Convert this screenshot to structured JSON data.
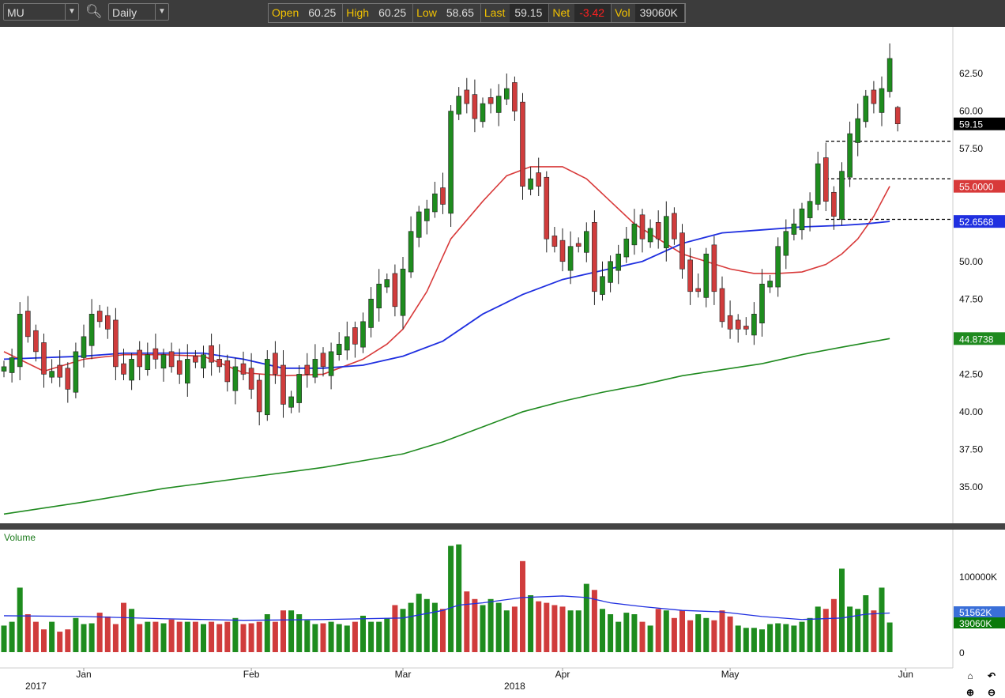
{
  "toolbar": {
    "symbol": "MU",
    "interval": "Daily",
    "search_icon": "magnifier-icon",
    "quote": [
      {
        "label": "Open",
        "value": "60.25"
      },
      {
        "label": "High",
        "value": "60.25"
      },
      {
        "label": "Low",
        "value": "58.65"
      },
      {
        "label": "Last",
        "value": "59.15"
      },
      {
        "label": "Net",
        "value": "-3.42"
      },
      {
        "label": "Vol",
        "value": "39060K"
      }
    ]
  },
  "colors": {
    "up": "#1e8c1e",
    "down": "#d03c3c",
    "ma20": "#d83a3a",
    "ma50": "#1f2fe0",
    "ma200": "#1f8a1f",
    "net": "#ff2020"
  },
  "chart_data": {
    "type": "candlestick",
    "symbol": "MU",
    "price_axis": {
      "ylim": [
        32.5,
        65
      ],
      "ticks": [
        "35.00",
        "37.50",
        "40.00",
        "42.50",
        "45.00",
        "47.50",
        "50.00",
        "52.50",
        "55.00",
        "57.50",
        "60.00",
        "62.50"
      ]
    },
    "x_labels": [
      {
        "label": "Jan",
        "index": 10
      },
      {
        "label": "Feb",
        "index": 31
      },
      {
        "label": "Mar",
        "index": 50
      },
      {
        "label": "Apr",
        "index": 70
      },
      {
        "label": "May",
        "index": 91
      },
      {
        "label": "Jun",
        "index": 113
      }
    ],
    "year_labels": [
      {
        "label": "2017",
        "index": 4
      },
      {
        "label": "2018",
        "index": 64
      }
    ],
    "closes": [
      43.0,
      43.6,
      46.5,
      45,
      44,
      42.5,
      42.7,
      42.3,
      41.5,
      44,
      45,
      46.5,
      46,
      45.5,
      43,
      42.5,
      43.5,
      43,
      43.8,
      43.5,
      43.8,
      43,
      42.5,
      43.5,
      43.3,
      43.8,
      43.3,
      43,
      42,
      43,
      42.5,
      41.5,
      40,
      43.5,
      42.5,
      40.5,
      41,
      42.5,
      42.5,
      43.5,
      43,
      44,
      44.5,
      45,
      44.5,
      46,
      47.5,
      48.5,
      48.8,
      47,
      49.5,
      52,
      53.3,
      53.5,
      54.5,
      53.8,
      60,
      61,
      60.5,
      59.5,
      60.5,
      60.5,
      61,
      61.5,
      60,
      55,
      55.5,
      55,
      51.5,
      51,
      50,
      51,
      51,
      52,
      48,
      49,
      50,
      50.5,
      51.5,
      52.5,
      51.5,
      52.2,
      51.5,
      53,
      51.5,
      49.5,
      48,
      48,
      50.5,
      48,
      46,
      45.5,
      45.5,
      45.5,
      46.5,
      48.5,
      48.7,
      51,
      52,
      52.5,
      53.5,
      54,
      56.5,
      54,
      53,
      56,
      58.5,
      59.5,
      61,
      60.5,
      61.5,
      63.5
    ],
    "last_candle": {
      "open": 60.25,
      "high": 60.25,
      "low": 58.65,
      "close": 59.15
    },
    "moving_averages": [
      {
        "name": "MA20",
        "badge": "55.0000",
        "points": [
          [
            0,
            44
          ],
          [
            5,
            42.7
          ],
          [
            10,
            43.5
          ],
          [
            15,
            43.8
          ],
          [
            20,
            43.8
          ],
          [
            25,
            43.7
          ],
          [
            30,
            42.6
          ],
          [
            35,
            42.4
          ],
          [
            40,
            42.5
          ],
          [
            45,
            43.5
          ],
          [
            48,
            44.5
          ],
          [
            50,
            45.5
          ],
          [
            53,
            48
          ],
          [
            56,
            51.5
          ],
          [
            60,
            54
          ],
          [
            63,
            55.7
          ],
          [
            66,
            56.3
          ],
          [
            70,
            56.3
          ],
          [
            73,
            55.5
          ],
          [
            76,
            54
          ],
          [
            79,
            52.5
          ],
          [
            82,
            51.5
          ],
          [
            85,
            50.5
          ],
          [
            88,
            50
          ],
          [
            91,
            49.5
          ],
          [
            94,
            49.2
          ],
          [
            97,
            49.2
          ],
          [
            100,
            49.3
          ],
          [
            103,
            49.8
          ],
          [
            105,
            50.5
          ],
          [
            107,
            51.5
          ],
          [
            109,
            53
          ],
          [
            111,
            55
          ]
        ]
      },
      {
        "name": "MA50",
        "badge": "52.6568",
        "points": [
          [
            0,
            43.5
          ],
          [
            10,
            43.7
          ],
          [
            15,
            43.9
          ],
          [
            25,
            43.9
          ],
          [
            30,
            43.5
          ],
          [
            35,
            42.9
          ],
          [
            40,
            42.9
          ],
          [
            45,
            43.1
          ],
          [
            50,
            43.7
          ],
          [
            55,
            44.7
          ],
          [
            60,
            46.5
          ],
          [
            65,
            47.8
          ],
          [
            70,
            48.8
          ],
          [
            75,
            49.4
          ],
          [
            80,
            50
          ],
          [
            85,
            51.2
          ],
          [
            90,
            51.9
          ],
          [
            95,
            52.1
          ],
          [
            100,
            52.3
          ],
          [
            105,
            52.4
          ],
          [
            108,
            52.5
          ],
          [
            111,
            52.66
          ]
        ]
      },
      {
        "name": "MA200",
        "badge": "44.8738",
        "points": [
          [
            0,
            33.2
          ],
          [
            10,
            34
          ],
          [
            20,
            34.9
          ],
          [
            30,
            35.6
          ],
          [
            40,
            36.3
          ],
          [
            50,
            37.2
          ],
          [
            55,
            38
          ],
          [
            60,
            39
          ],
          [
            65,
            40
          ],
          [
            70,
            40.7
          ],
          [
            75,
            41.3
          ],
          [
            80,
            41.8
          ],
          [
            85,
            42.4
          ],
          [
            90,
            42.8
          ],
          [
            95,
            43.2
          ],
          [
            100,
            43.8
          ],
          [
            105,
            44.3
          ],
          [
            111,
            44.87
          ]
        ]
      }
    ],
    "last_badge": "59.15",
    "support_lines": [
      58.0,
      55.5,
      52.8
    ],
    "volume": {
      "label": "Volume",
      "ticks": [
        "100000K",
        "0"
      ],
      "ma_badge": "51562K",
      "last_badge": "39060K",
      "values": [
        35000,
        40000,
        85000,
        50000,
        40000,
        30000,
        40000,
        27000,
        30000,
        45000,
        37000,
        38000,
        52000,
        47000,
        37000,
        65000,
        57000,
        37000,
        40000,
        40000,
        38000,
        43000,
        40000,
        40000,
        40000,
        37000,
        40000,
        37000,
        40000,
        45000,
        37000,
        38000,
        40000,
        50000,
        40000,
        55000,
        55000,
        50000,
        42000,
        37000,
        38000,
        40000,
        37000,
        35000,
        40000,
        48000,
        40000,
        40000,
        45000,
        62000,
        57000,
        65000,
        77000,
        70000,
        65000,
        57000,
        140000,
        142000,
        80000,
        70000,
        62000,
        70000,
        65000,
        55000,
        60000,
        120000,
        75000,
        67000,
        65000,
        62000,
        60000,
        55000,
        55000,
        90000,
        82000,
        57000,
        50000,
        40000,
        52000,
        50000,
        40000,
        35000,
        57000,
        55000,
        45000,
        55000,
        42000,
        50000,
        45000,
        42000,
        55000,
        47000,
        35000,
        32000,
        32000,
        30000,
        37000,
        38000,
        37000,
        35000,
        40000,
        45000,
        60000,
        57000,
        70000,
        110000,
        60000,
        57000,
        75000,
        55000,
        85000,
        39060
      ],
      "ma": [
        [
          0,
          48000
        ],
        [
          10,
          47000
        ],
        [
          20,
          44000
        ],
        [
          30,
          42000
        ],
        [
          40,
          43000
        ],
        [
          50,
          45000
        ],
        [
          55,
          55000
        ],
        [
          57,
          62000
        ],
        [
          60,
          65000
        ],
        [
          65,
          72000
        ],
        [
          70,
          74000
        ],
        [
          73,
          72000
        ],
        [
          76,
          65000
        ],
        [
          80,
          60000
        ],
        [
          85,
          55000
        ],
        [
          90,
          53000
        ],
        [
          95,
          47000
        ],
        [
          100,
          43000
        ],
        [
          105,
          45000
        ],
        [
          108,
          50000
        ],
        [
          111,
          51562
        ]
      ]
    }
  }
}
